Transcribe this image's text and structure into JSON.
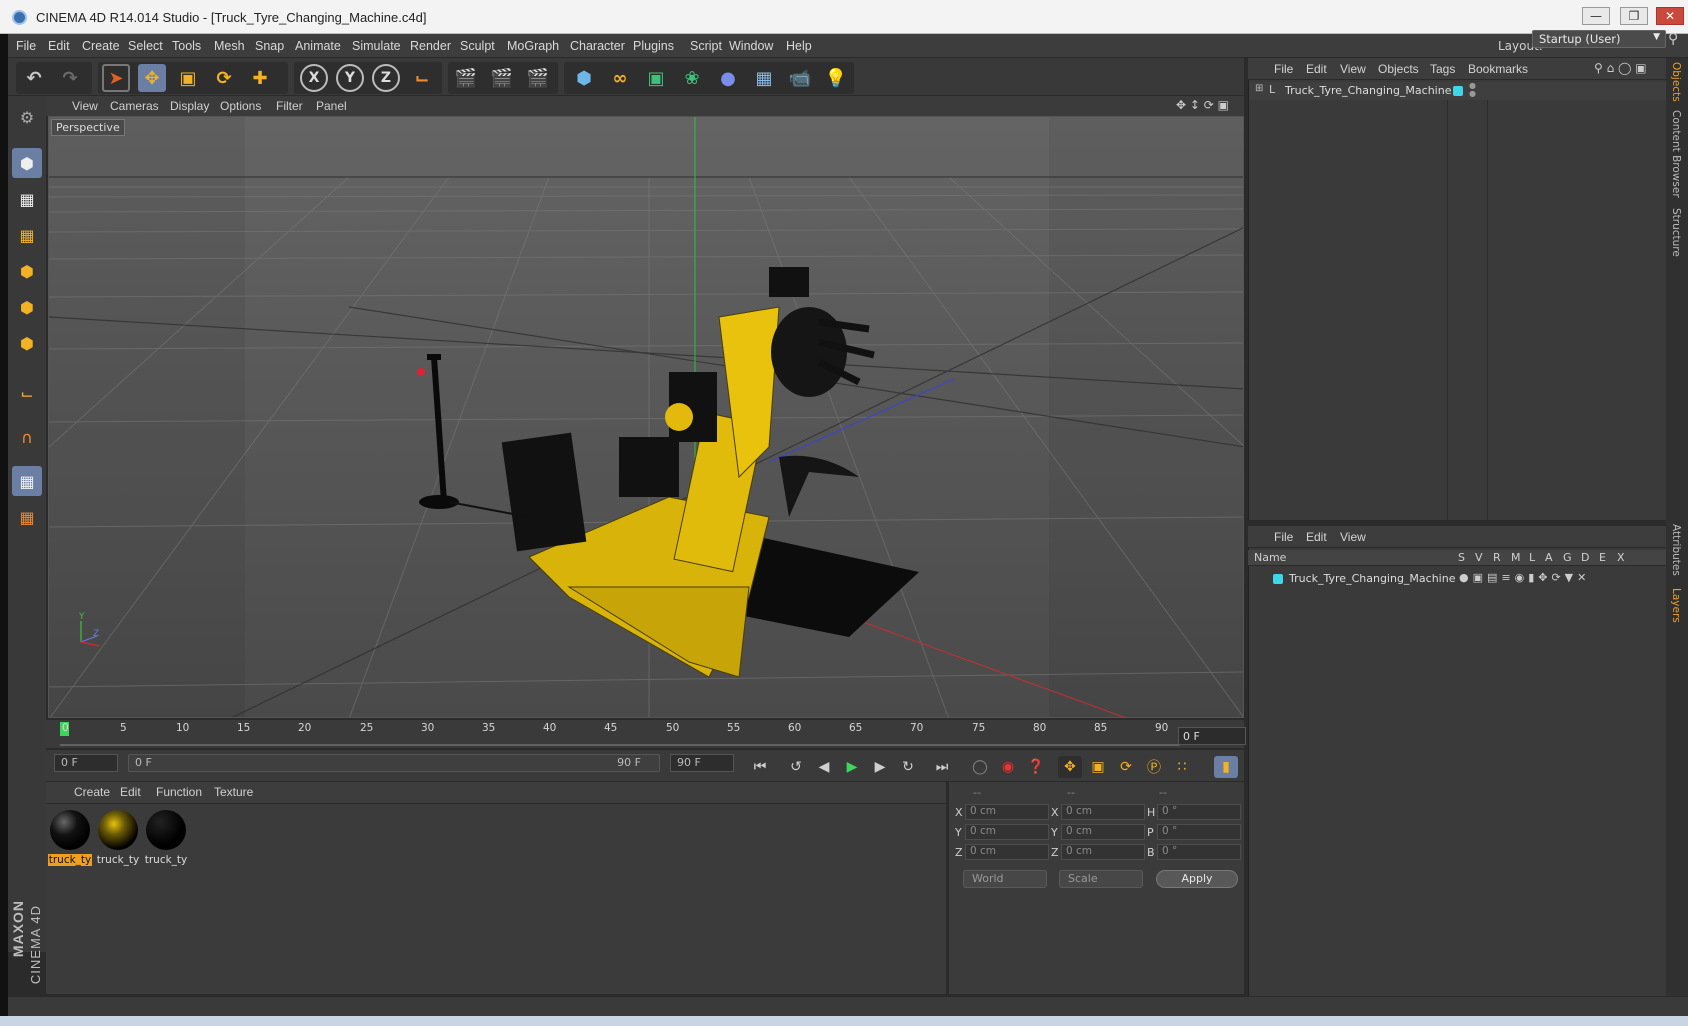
{
  "window": {
    "title": "CINEMA 4D R14.014 Studio - [Truck_Tyre_Changing_Machine.c4d]",
    "minimize_icon": "minimize-icon",
    "maximize_icon": "restore-icon",
    "close_icon": "close-icon"
  },
  "menubar": {
    "items": [
      "File",
      "Edit",
      "Create",
      "Select",
      "Tools",
      "Mesh",
      "Snap",
      "Animate",
      "Simulate",
      "Render",
      "Sculpt",
      "MoGraph",
      "Character",
      "Plugins",
      "Script",
      "Window",
      "Help"
    ],
    "layout_label": "Layout:",
    "layout_value": "Startup (User)"
  },
  "toolbar": {
    "axis_x": "X",
    "axis_y": "Y",
    "axis_z": "Z"
  },
  "viewport": {
    "menu": [
      "View",
      "Cameras",
      "Display",
      "Options",
      "Filter",
      "Panel"
    ],
    "camera_label": "Perspective",
    "axis_y": "Y",
    "axis_z": "Z"
  },
  "timeline": {
    "ticks": [
      "0",
      "5",
      "10",
      "15",
      "20",
      "25",
      "30",
      "35",
      "40",
      "45",
      "50",
      "55",
      "60",
      "65",
      "70",
      "75",
      "80",
      "85",
      "90"
    ],
    "current_frame": "0 F"
  },
  "transport": {
    "start_field": "0 F",
    "range_start": "0 F",
    "range_end": "90 F",
    "end_field": "90 F"
  },
  "materials": {
    "menu": [
      "Create",
      "Edit",
      "Function",
      "Texture"
    ],
    "items": [
      "truck_ty",
      "truck_ty",
      "truck_ty"
    ]
  },
  "coordinates": {
    "headers": [
      "--",
      "--",
      "--"
    ],
    "rows": [
      {
        "a": "X",
        "av": "0 cm",
        "b": "X",
        "bv": "0 cm",
        "c": "H",
        "cv": "0 °"
      },
      {
        "a": "Y",
        "av": "0 cm",
        "b": "Y",
        "bv": "0 cm",
        "c": "P",
        "cv": "0 °"
      },
      {
        "a": "Z",
        "av": "0 cm",
        "b": "Z",
        "bv": "0 cm",
        "c": "B",
        "cv": "0 °"
      }
    ],
    "mode": "World",
    "scale": "Scale",
    "apply": "Apply"
  },
  "objects_panel": {
    "menu": [
      "File",
      "Edit",
      "View",
      "Objects",
      "Tags",
      "Bookmarks"
    ],
    "object_name": "Truck_Tyre_Changing_Machine",
    "tag_color": "#3ed6e8"
  },
  "layers_panel": {
    "menu": [
      "File",
      "Edit",
      "View"
    ],
    "columns": [
      "Name",
      "S",
      "V",
      "R",
      "M",
      "L",
      "A",
      "G",
      "D",
      "E",
      "X"
    ],
    "layer_name": "Truck_Tyre_Changing_Machine",
    "layer_color": "#3ed6e8"
  },
  "right_tabs": [
    "Objects",
    "Content Browser",
    "Structure",
    "Attributes",
    "Layers"
  ],
  "logo": {
    "brand": "MAXON",
    "product": "CINEMA 4D"
  },
  "colors": {
    "accent": "#f0a020",
    "active_tool": "#6a7fa3",
    "model_yellow": "#e8c20c"
  }
}
